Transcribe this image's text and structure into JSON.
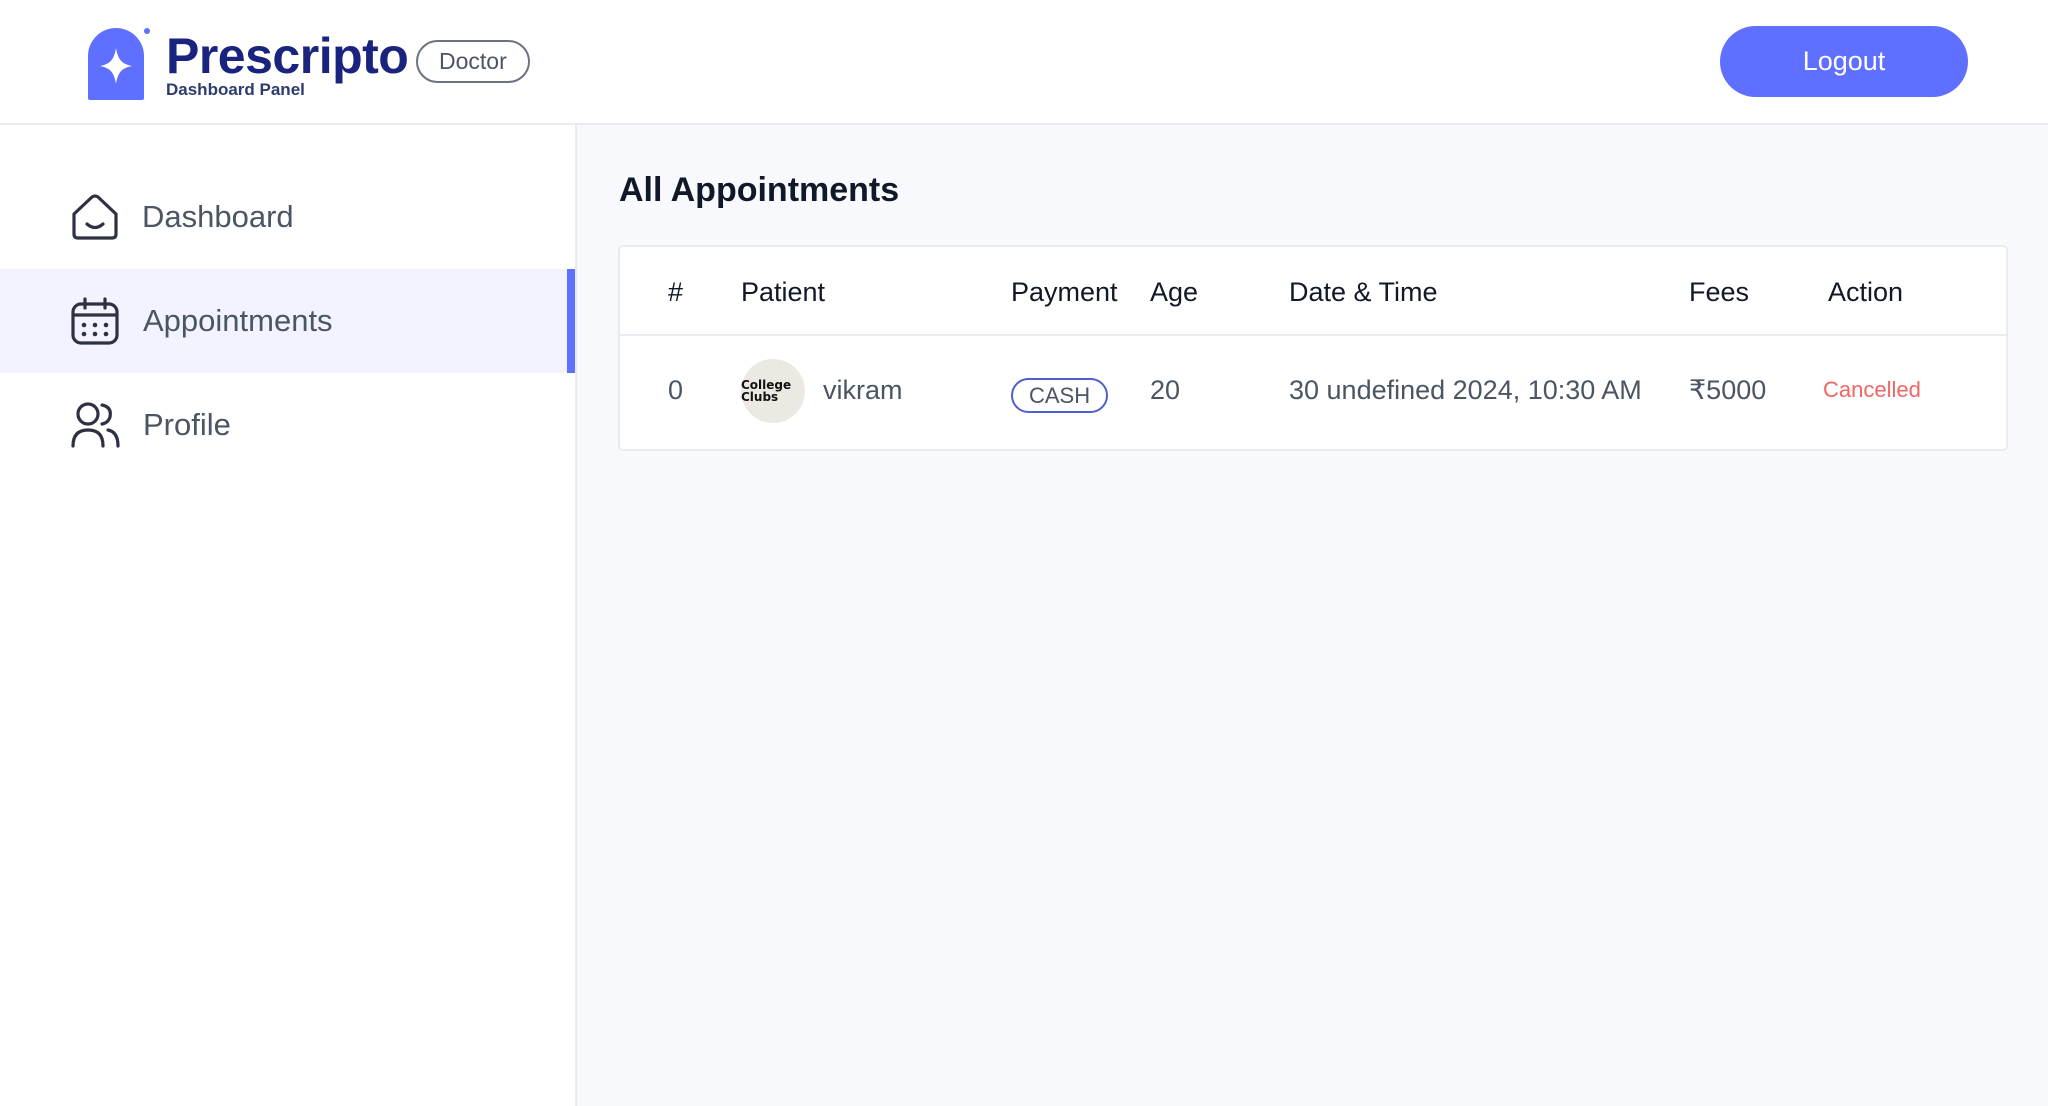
{
  "brand": {
    "name": "Prescripto",
    "subtitle": "Dashboard Panel",
    "role": "Doctor",
    "accent": "#5f6fff"
  },
  "header": {
    "logout_label": "Logout"
  },
  "sidebar": {
    "items": [
      {
        "label": "Dashboard",
        "icon": "home-icon",
        "active": false
      },
      {
        "label": "Appointments",
        "icon": "calendar-icon",
        "active": true
      },
      {
        "label": "Profile",
        "icon": "people-icon",
        "active": false
      }
    ]
  },
  "main": {
    "title": "All Appointments",
    "columns": [
      "#",
      "Patient",
      "Payment",
      "Age",
      "Date & Time",
      "Fees",
      "Action"
    ],
    "rows": [
      {
        "index": "0",
        "avatar_text": "College Clubs",
        "patient": "vikram",
        "payment": "CASH",
        "age": "20",
        "datetime": "30 undefined 2024, 10:30 AM",
        "fees": "₹5000",
        "action": "Cancelled"
      }
    ]
  },
  "colors": {
    "accent": "#5f6fff",
    "active_bg": "#f2f3ff",
    "cancelled": "#f06565",
    "brand_text": "#1a237e"
  }
}
